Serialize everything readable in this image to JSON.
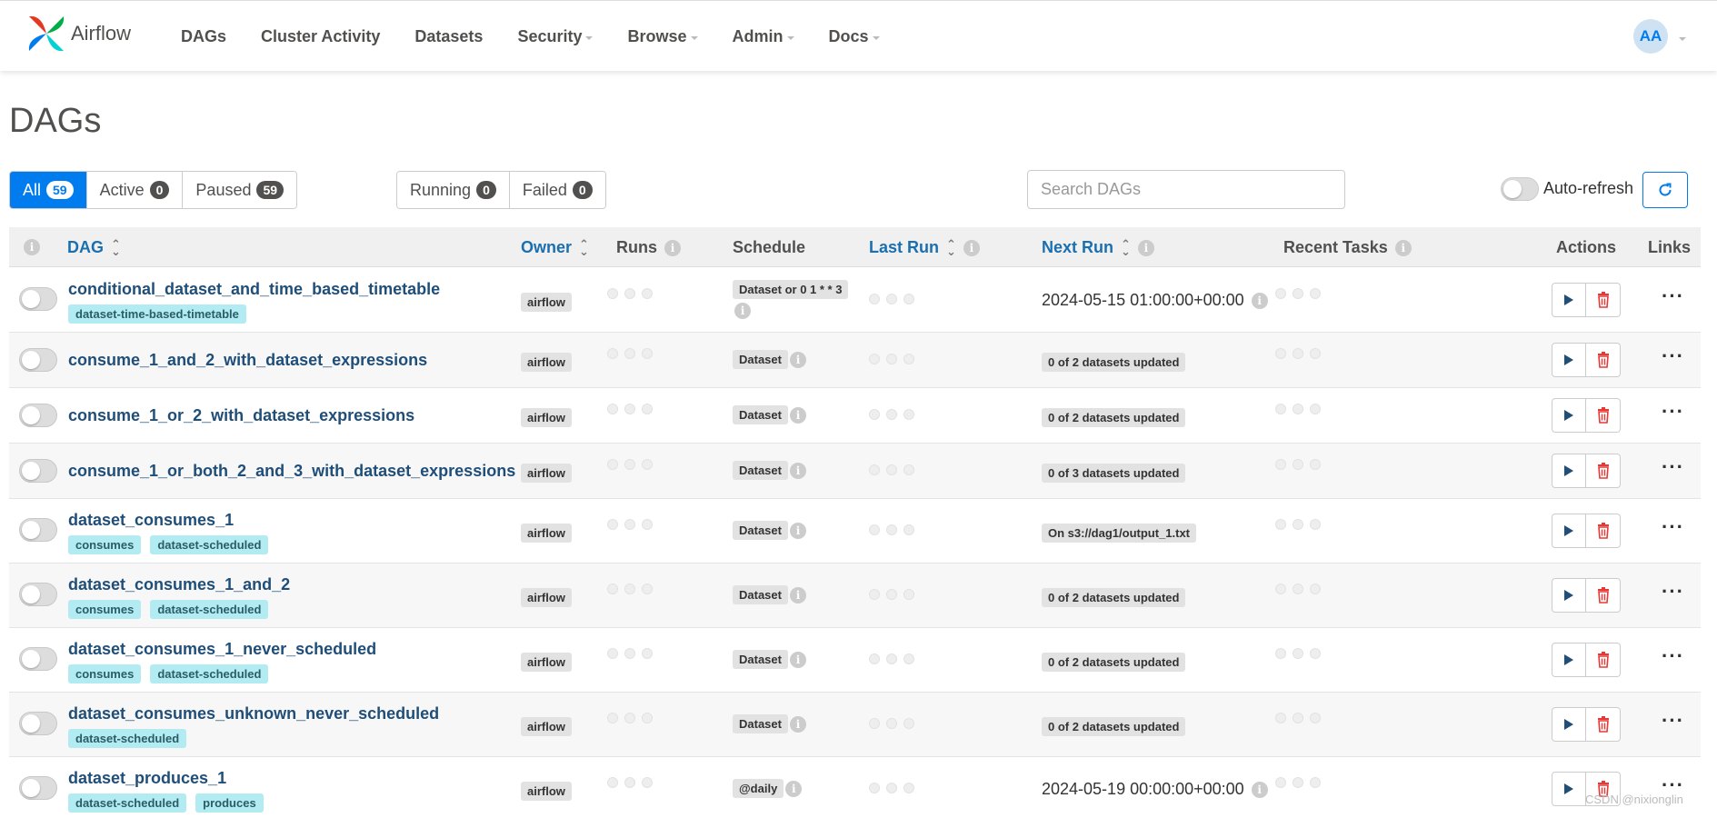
{
  "app": {
    "name": "Airflow"
  },
  "nav": {
    "items": [
      {
        "label": "DAGs",
        "caret": false
      },
      {
        "label": "Cluster Activity",
        "caret": false
      },
      {
        "label": "Datasets",
        "caret": false
      },
      {
        "label": "Security",
        "caret": true
      },
      {
        "label": "Browse",
        "caret": true
      },
      {
        "label": "Admin",
        "caret": true
      },
      {
        "label": "Docs",
        "caret": true
      }
    ],
    "user_initials": "AA"
  },
  "page": {
    "title": "DAGs"
  },
  "filters": {
    "all": {
      "label": "All",
      "count": "59"
    },
    "active": {
      "label": "Active",
      "count": "0"
    },
    "paused": {
      "label": "Paused",
      "count": "59"
    },
    "running": {
      "label": "Running",
      "count": "0"
    },
    "failed": {
      "label": "Failed",
      "count": "0"
    }
  },
  "search": {
    "placeholder": "Search DAGs"
  },
  "auto_refresh": {
    "label": "Auto-refresh"
  },
  "table": {
    "headers": {
      "dag": "DAG",
      "owner": "Owner",
      "runs": "Runs",
      "schedule": "Schedule",
      "last_run": "Last Run",
      "next_run": "Next Run",
      "recent_tasks": "Recent Tasks",
      "actions": "Actions",
      "links": "Links"
    },
    "rows": [
      {
        "name": "conditional_dataset_and_time_based_timetable",
        "tags": [
          "dataset-time-based-timetable"
        ],
        "owner": "airflow",
        "schedule": "Dataset or 0 1 * * 3",
        "next_run": "2024-05-15 01:00:00+00:00",
        "next_run_type": "text"
      },
      {
        "name": "consume_1_and_2_with_dataset_expressions",
        "tags": [],
        "owner": "airflow",
        "schedule": "Dataset",
        "next_run": "0 of 2 datasets updated",
        "next_run_type": "badge"
      },
      {
        "name": "consume_1_or_2_with_dataset_expressions",
        "tags": [],
        "owner": "airflow",
        "schedule": "Dataset",
        "next_run": "0 of 2 datasets updated",
        "next_run_type": "badge"
      },
      {
        "name": "consume_1_or_both_2_and_3_with_dataset_expressions",
        "tags": [],
        "owner": "airflow",
        "schedule": "Dataset",
        "next_run": "0 of 3 datasets updated",
        "next_run_type": "badge"
      },
      {
        "name": "dataset_consumes_1",
        "tags": [
          "consumes",
          "dataset-scheduled"
        ],
        "owner": "airflow",
        "schedule": "Dataset",
        "next_run": "On s3://dag1/output_1.txt",
        "next_run_type": "badge"
      },
      {
        "name": "dataset_consumes_1_and_2",
        "tags": [
          "consumes",
          "dataset-scheduled"
        ],
        "owner": "airflow",
        "schedule": "Dataset",
        "next_run": "0 of 2 datasets updated",
        "next_run_type": "badge"
      },
      {
        "name": "dataset_consumes_1_never_scheduled",
        "tags": [
          "consumes",
          "dataset-scheduled"
        ],
        "owner": "airflow",
        "schedule": "Dataset",
        "next_run": "0 of 2 datasets updated",
        "next_run_type": "badge"
      },
      {
        "name": "dataset_consumes_unknown_never_scheduled",
        "tags": [
          "dataset-scheduled"
        ],
        "owner": "airflow",
        "schedule": "Dataset",
        "next_run": "0 of 2 datasets updated",
        "next_run_type": "badge"
      },
      {
        "name": "dataset_produces_1",
        "tags": [
          "dataset-scheduled",
          "produces"
        ],
        "owner": "airflow",
        "schedule": "@daily",
        "next_run": "2024-05-19 00:00:00+00:00",
        "next_run_type": "text"
      }
    ]
  },
  "watermark": "CSDN @nixionglin",
  "colors": {
    "primary": "#017cee",
    "danger": "#e53935",
    "tag_bg": "#b2ebf2"
  }
}
